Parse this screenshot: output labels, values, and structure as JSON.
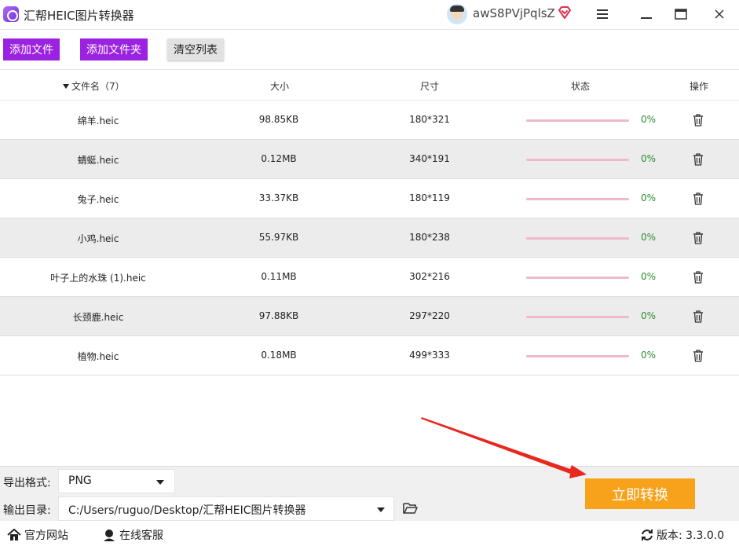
{
  "app": {
    "title": "汇帮HEIC图片转换器"
  },
  "user": {
    "name": "awS8PVjPqlsZ"
  },
  "window": {
    "menu_icon": "menu-icon",
    "maximize_icon": "maximize-icon",
    "close_icon": "close-icon"
  },
  "toolbar": {
    "add_file": "添加文件",
    "add_folder": "添加文件夹",
    "clear_list": "清空列表"
  },
  "table": {
    "headers": {
      "name": "文件名（7）",
      "size": "大小",
      "dimensions": "尺寸",
      "status": "状态",
      "action": "操作"
    },
    "rows": [
      {
        "name": "绵羊.heic",
        "size": "98.85KB",
        "dimensions": "180*321",
        "progress": 0,
        "percent": "0%"
      },
      {
        "name": "蜻蜓.heic",
        "size": "0.12MB",
        "dimensions": "340*191",
        "progress": 0,
        "percent": "0%"
      },
      {
        "name": "兔子.heic",
        "size": "33.37KB",
        "dimensions": "180*119",
        "progress": 0,
        "percent": "0%"
      },
      {
        "name": "小鸡.heic",
        "size": "55.97KB",
        "dimensions": "180*238",
        "progress": 0,
        "percent": "0%"
      },
      {
        "name": "叶子上的水珠 (1).heic",
        "size": "0.11MB",
        "dimensions": "302*216",
        "progress": 0,
        "percent": "0%"
      },
      {
        "name": "长颈鹿.heic",
        "size": "97.88KB",
        "dimensions": "297*220",
        "progress": 0,
        "percent": "0%"
      },
      {
        "name": "植物.heic",
        "size": "0.18MB",
        "dimensions": "499*333",
        "progress": 0,
        "percent": "0%"
      }
    ]
  },
  "output": {
    "format_label": "导出格式:",
    "format_value": "PNG",
    "dir_label": "输出目录:",
    "dir_value": "C:/Users/ruguo/Desktop/汇帮HEIC图片转换器"
  },
  "convert": {
    "label": "立即转换"
  },
  "footer": {
    "website": "官方网站",
    "support": "在线客服",
    "version": "版本: 3.3.0.0"
  },
  "colors": {
    "accent_purple": "#9b22e0",
    "convert_orange": "#f7a21a",
    "progress_track": "#f0b9c9",
    "percent_green": "#2e8b2e",
    "arrow_red": "#e8281e"
  }
}
